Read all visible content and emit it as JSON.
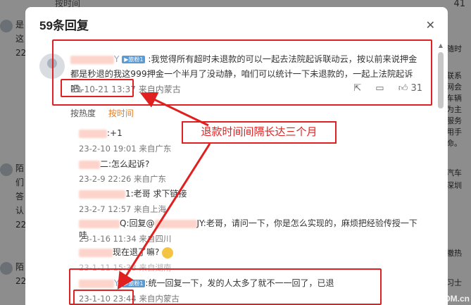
{
  "background": {
    "top_text": "按时间",
    "left_items": [
      "是",
      "这",
      "22",
      "陌",
      "们",
      "答",
      "认",
      "22",
      "陌",
      "22"
    ],
    "right_items": [
      "随时",
      "联系",
      "网会",
      "车辆",
      "为主",
      "服务",
      "用手",
      "命。",
      "汽车",
      "深圳",
      "撤热",
      "习士"
    ],
    "right_number": "41"
  },
  "modal": {
    "title": "59条回复",
    "close_label": "✕",
    "main_comment": {
      "name_suffix": "Y",
      "badge": "▶旅粉1",
      "text": ":我觉得所有超时未退款的可以一起去法院起诉联动云，按以前来说押金都是秒退的我这999押金一个半月了没动静，咱们可以统计一下未退款的，一起上法院起诉吧。",
      "time": "22-10-21 13:37",
      "location": "来自内蒙古",
      "like_count": "31"
    },
    "sort": {
      "hot": "按热度",
      "time": "按时间"
    },
    "replies": [
      {
        "name": "",
        "text": ":+1",
        "time": "23-2-10 19:01",
        "location": "来自广东"
      },
      {
        "name": "",
        "text": "二:怎么起诉?",
        "time": "23-2-9 22:26",
        "location": "来自广东"
      },
      {
        "name": "",
        "text": "1:老哥 求下链接",
        "time": "23-2-7 12:57",
        "location": "来自上海"
      },
      {
        "name": "",
        "text_prefix": "Q:回复@",
        "text_suffix": "JY:老哥，请问一下，你是怎么实现的，麻烦把经验传授一下哇",
        "time": "23-1-16 11:34",
        "location": "来自四川"
      },
      {
        "name": "",
        "text": "现在退了嘛?",
        "time": "23-1-11 15:38",
        "location": "来自湖南"
      },
      {
        "name": "",
        "text_prefix": "Y",
        "badge": "▶旅粉1",
        "text": ":统一回复一下，发的人太多了就不一一回了，已退",
        "time": "23-1-10 23:44",
        "location": "来自内蒙古"
      }
    ],
    "callout": "退款时间间隔长达三个月"
  },
  "watermark": "OM.cn",
  "colors": {
    "highlight_red": "#e02020",
    "accent_orange": "#e67e22"
  }
}
